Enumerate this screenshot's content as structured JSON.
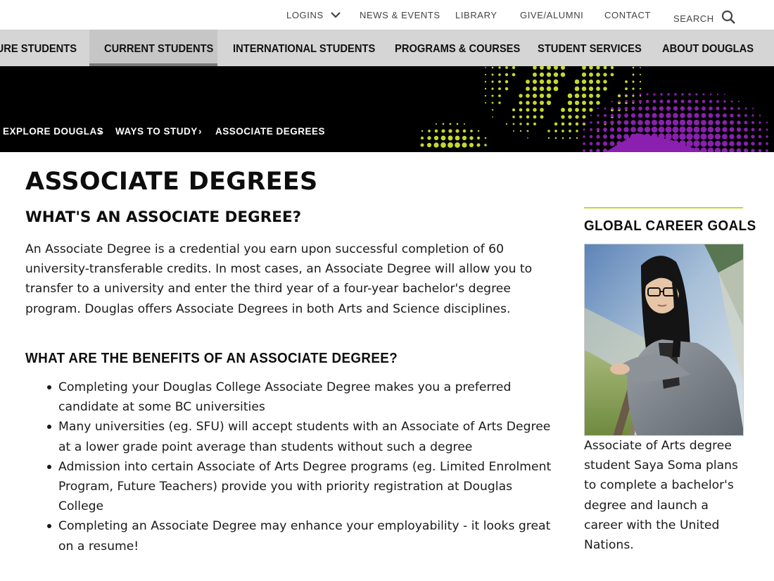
{
  "utility_nav": {
    "logins": "LOGINS",
    "news": "NEWS & EVENTS",
    "library": "LIBRARY",
    "give": "GIVE/ALUMNI",
    "contact": "CONTACT",
    "search": "SEARCH"
  },
  "main_nav": {
    "future": "FUTURE STUDENTS",
    "current": "CURRENT STUDENTS",
    "international": "INTERNATIONAL STUDENTS",
    "programs": "PROGRAMS & COURSES",
    "services": "STUDENT SERVICES",
    "about": "ABOUT DOUGLAS"
  },
  "breadcrumb": {
    "item1": "EXPLORE DOUGLAS",
    "item2": "WAYS TO STUDY",
    "item3": "ASSOCIATE DEGREES",
    "separator": "›"
  },
  "page": {
    "title": "ASSOCIATE DEGREES",
    "subtitle": "WHAT'S AN ASSOCIATE DEGREE?",
    "intro": "An Associate Degree is a credential you earn upon successful completion of 60 university-transferable credits. In most cases, an Associate Degree will allow you to transfer to a university and enter the third year of a four-year bachelor's degree program. Douglas offers Associate Degrees in both Arts and Science disciplines.",
    "benefits_heading": "WHAT ARE THE BENEFITS OF AN ASSOCIATE DEGREE?",
    "benefits": [
      "Completing your Douglas College Associate Degree makes you a preferred candidate at some BC universities",
      "Many universities (eg. SFU) will accept students with an Associate of Arts Degree at a lower grade point average than students without such a degree",
      "Admission into certain Associate of Arts Degree programs (eg. Limited Enrolment Program, Future Teachers) provide you with priority registration at Douglas College",
      "Completing an Associate Degree may enhance your employability - it looks great on a resume!"
    ]
  },
  "sidebar": {
    "title": "GLOBAL CAREER GOALS",
    "caption": "Associate of Arts degree student Saya Soma plans to complete a bachelor's degree and launch a career with the United Nations."
  },
  "colors": {
    "accent_lime": "#c5d82b",
    "accent_purple": "#8a1fb0",
    "nav_bg": "#d5d5d5"
  },
  "icons": {
    "logins_dropdown": "chevron-down-icon",
    "search": "search-icon",
    "breadcrumb_separator": "chevron-right-icon"
  }
}
